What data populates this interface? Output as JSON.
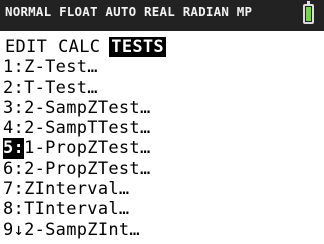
{
  "status_bar": {
    "text": "NORMAL FLOAT AUTO REAL RADIAN MP",
    "battery": {
      "icon": "battery-icon",
      "fill_color": "#7bd14b"
    }
  },
  "menu": {
    "tabs": [
      {
        "label": "EDIT",
        "active": false
      },
      {
        "label": "CALC",
        "active": false
      },
      {
        "label": "TESTS",
        "active": true
      }
    ],
    "items": [
      {
        "number": "1:",
        "label": "Z-Test…",
        "selected": false
      },
      {
        "number": "2:",
        "label": "T-Test…",
        "selected": false
      },
      {
        "number": "3:",
        "label": "2-SampZTest…",
        "selected": false
      },
      {
        "number": "4:",
        "label": "2-SampTTest…",
        "selected": false
      },
      {
        "number": "5:",
        "label": "1-PropZTest…",
        "selected": true
      },
      {
        "number": "6:",
        "label": "2-PropZTest…",
        "selected": false
      },
      {
        "number": "7:",
        "label": "ZInterval…",
        "selected": false
      },
      {
        "number": "8:",
        "label": "TInterval…",
        "selected": false
      },
      {
        "number": "9↓",
        "label": "2-SampZInt…",
        "selected": false
      }
    ]
  },
  "colors": {
    "status_bar_bg": "#222222",
    "highlight_bg": "#000000",
    "highlight_fg": "#ffffff"
  }
}
